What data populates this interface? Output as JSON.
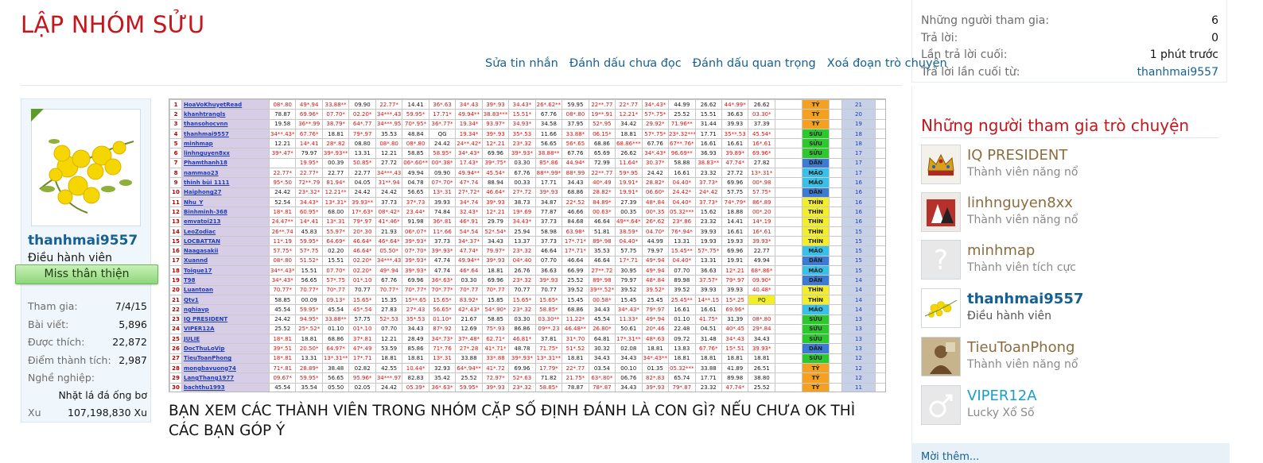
{
  "thread": {
    "title": "LẬP NHÓM SỬU",
    "caption": "BẠN XEM CÁC THÀNH VIÊN TRONG NHÓM CẶP SỐ ĐỊNH ĐÁNH LÀ CON GÌ? NẾU CHƯA OK THÌ CÁC BẠN GÓP Ý",
    "actions": [
      "Sửa tin nhắn",
      "Đánh dấu chưa đọc",
      "Đánh dấu quan trọng",
      "Xoá đoạn trò chuyện"
    ]
  },
  "poster": {
    "username": "thanhmai9557",
    "role": "Điều hành viên",
    "banner": "Miss thân thiện",
    "stats": [
      {
        "label": "Tham gia:",
        "value": "7/4/15"
      },
      {
        "label": "Bài viết:",
        "value": "5,896"
      },
      {
        "label": "Được thích:",
        "value": "22,872"
      },
      {
        "label": "Điểm thành tích:",
        "value": "2,987"
      }
    ],
    "job_label": "Nghề nghiệp:",
    "job_value": "Nhặt lá đá ống bơ",
    "xu_label": "Xu",
    "xu_value": "107,198,830 Xu"
  },
  "conversation_info": {
    "rows": [
      {
        "label": "Những người tham gia:",
        "value": "6"
      },
      {
        "label": "Trả lời:",
        "value": "0"
      },
      {
        "label": "Lần trả lời cuối:",
        "value": "1 phút trước"
      },
      {
        "label": "Trả lời lần cuối từ:",
        "value": "thanhmai9557"
      }
    ]
  },
  "participants": {
    "heading": "Những người tham gia trò chuyện",
    "members": [
      {
        "name": "IQ PRESIDENT",
        "title": "Thành viên năng nổ",
        "icon": "crown-icon"
      },
      {
        "name": "linhnguyen8xx",
        "title": "Thành viên năng nổ",
        "icon": "photo-avatar"
      },
      {
        "name": "minhmap",
        "title": "Thành viên tích cực",
        "icon": "question-mark-icon"
      },
      {
        "name": "thanhmai9557",
        "title": "Điều hành viên",
        "icon": "flower-avatar"
      },
      {
        "name": "TieuToanPhong",
        "title": "Thành viên năng nổ",
        "icon": "photo-avatar"
      },
      {
        "name": "VIPER12A",
        "title": "Lucky Xổ Số",
        "icon": "male-symbol-icon"
      }
    ],
    "invite_label": "Mời thêm..."
  },
  "sheet": {
    "rows": [
      {
        "n": "1",
        "name": "HoaVoKhuyetRead",
        "cells": [
          "08*.80",
          "49*.94",
          "33.88**",
          "09.90",
          "22.77*",
          "14.41",
          "36*.63",
          "34*.43",
          "39*.93",
          "34.43*",
          "26*.62**",
          "59.95",
          "22**.77",
          "22*.77",
          "34*.43*",
          "44.99",
          "26.62",
          "44*.99*",
          "26.62"
        ],
        "tag": "TÝ",
        "rank": "21",
        "color": "#f4a020"
      },
      {
        "n": "2",
        "name": "khanhtrangls",
        "cells": [
          "78.87",
          "69.96*",
          "07.70*",
          "02.20*",
          "34***.43",
          "59.95*",
          "17.71*",
          "49.94**",
          "38.83***",
          "15.51*",
          "67.76",
          "08*.80",
          "19**.91",
          "12.21*",
          "57*.75*",
          "25.52",
          "15.51",
          "36.63",
          "03.30*"
        ],
        "tag": "TÝ",
        "rank": "20",
        "color": "#f4a020"
      },
      {
        "n": "3",
        "name": "thansohocvnn",
        "cells": [
          "19.58",
          "36**.99",
          "38.79*",
          "64*.77",
          "34***.95",
          "70*.95*",
          "36*.77*",
          "19.34*",
          "93.97*",
          "34.93*",
          "34.58",
          "37.95",
          "52*.95",
          "34.42",
          "29.92*",
          "71.96**",
          "31.44",
          "39.93",
          "37.39"
        ],
        "tag": "TÝ",
        "rank": "19",
        "color": "#f4a020"
      },
      {
        "n": "4",
        "name": "thanhmai9557",
        "cells": [
          "34**.43*",
          "67.76*",
          "18.81",
          "79*.97",
          "35.53",
          "48.84",
          "QG",
          "19.34*",
          "39*.93",
          "35*.53",
          "11.66",
          "33.88*",
          "06.15*",
          "18.81",
          "57*.75*",
          "23*.32***",
          "17.71",
          "35**.53",
          "45.54*"
        ],
        "tag": "SỬU",
        "rank": "18",
        "color": "#2cc92c"
      },
      {
        "n": "5",
        "name": "minhmap",
        "cells": [
          "12.21",
          "14*.41",
          "28*.82",
          "08.80",
          "08*.80",
          "08*.80",
          "24.42",
          "24**.42*",
          "12*.21",
          "23*.32",
          "56.65",
          "56*.65",
          "68.86",
          "68.86***",
          "67.76",
          "67**.76*",
          "16.61",
          "16.61",
          "16*.61"
        ],
        "tag": "SỬU",
        "rank": "18",
        "color": "#2cc92c"
      },
      {
        "n": "6",
        "name": "linhnguyen8xx",
        "cells": [
          "39*.47*",
          "79.97",
          "39*.93**",
          "13.31",
          "12.21",
          "58.85",
          "58.95*",
          "34*.43*",
          "69.96",
          "39*.93*",
          "38.88**",
          "67.76",
          "65.69",
          "26.62",
          "34*.43*",
          "96.69**",
          "36.93",
          "39.89*",
          "69.96*"
        ],
        "tag": "SỬU",
        "rank": "17",
        "color": "#2cc92c"
      },
      {
        "n": "7",
        "name": "Phamthanh18",
        "cells": [
          "",
          "19.95*",
          "00.39",
          "50.85*",
          "27.72",
          "06*.60**",
          "00*.38*",
          "17.43*",
          "39*.75*",
          "03.30",
          "85*.86",
          "44.94*",
          "72.99",
          "11.64*",
          "30.37*",
          "58.88",
          "38.83**",
          "47.74*",
          "27.82"
        ],
        "tag": "DẦN",
        "rank": "17",
        "color": "#3b7bd4"
      },
      {
        "n": "8",
        "name": "nammao23",
        "cells": [
          "22.77*",
          "22.77*",
          "22.77",
          "22.77",
          "34***.43",
          "49.94",
          "09.90",
          "49.94**",
          "45.54*",
          "67.76",
          "88**.99*",
          "88*.99",
          "22**.77",
          "59*.95",
          "24.42",
          "16.61",
          "23.32",
          "27.72",
          "13*.31*"
        ],
        "tag": "MÃO",
        "rank": "17",
        "color": "#38c0e6"
      },
      {
        "n": "9",
        "name": "thinh bùi 1111",
        "cells": [
          "95*.50",
          "72**.79",
          "81.94*",
          "04.05",
          "31**.94",
          "04.78",
          "07*.70*",
          "47*.74",
          "88.94",
          "00.33",
          "17.71",
          "34.43",
          "40*.49",
          "19.91*",
          "28.82*",
          "04.40*",
          "37.73*",
          "69.96",
          "00*.98"
        ],
        "tag": "MÃO",
        "rank": "16",
        "color": "#38c0e6"
      },
      {
        "n": "10",
        "name": "Haiphong27",
        "cells": [
          "24.42",
          "23*.32*",
          "12.21**",
          "24.42",
          "24.42",
          "56.65",
          "13*.31",
          "27*.72*",
          "46.64*",
          "27*.72",
          "39*.93",
          "68.86",
          "28.82*",
          "19.91*",
          "06.60*",
          "24.42*",
          "24*.42",
          "57.75",
          "57.75*"
        ],
        "tag": "DẦN",
        "rank": "16",
        "color": "#3b7bd4"
      },
      {
        "n": "11",
        "name": "Nhu_Y",
        "cells": [
          "52.54",
          "34.43*",
          "13*.31*",
          "39.93**",
          "37.73",
          "37*.73",
          "39.93",
          "34*.74",
          "39*.93",
          "38.73",
          "34.87",
          "22*.52",
          "84.89*",
          "27.39",
          "48*.84",
          "04.40*",
          "37.73*",
          "74*.79*",
          "86*.89"
        ],
        "tag": "THÌN",
        "rank": "16",
        "color": "#f2ee2a"
      },
      {
        "n": "12",
        "name": "Binhminh-368",
        "cells": [
          "18*.81",
          "60.95*",
          "68.00",
          "17*.63*",
          "08*.42*",
          "23.44*",
          "74.84",
          "32.43*",
          "12*.21",
          "19*.69",
          "77.87",
          "46.66",
          "00.63*",
          "00.35",
          "00*.35",
          "05.32***",
          "15.62",
          "18.88",
          "00*.20"
        ],
        "tag": "THÌN",
        "rank": "16",
        "color": "#f2ee2a"
      },
      {
        "n": "13",
        "name": "emvatoi213",
        "cells": [
          "24.47**",
          "14*.41",
          "13*.31",
          "79*.97",
          "41*.46*",
          "91.98",
          "36*.81",
          "46*.91",
          "29.79",
          "34.43*",
          "37.73",
          "84.68",
          "46.64",
          "49**.64*",
          "26*.62",
          "23*.86",
          "23.32",
          "14.41",
          "14*.19"
        ],
        "tag": "THÌN",
        "rank": "16",
        "color": "#f2ee2a"
      },
      {
        "n": "14",
        "name": "LeoZodiac",
        "cells": [
          "26**.74",
          "45.83",
          "55.97*",
          "20*.30",
          "21.93",
          "06*.07*",
          "11*.66",
          "54*.54",
          "52*.54*",
          "25.94",
          "58.98",
          "63.98*",
          "51.81",
          "38.59*",
          "04.70*",
          "76*.94*",
          "39.93",
          "16.61",
          "16*.61"
        ],
        "tag": "THÌN",
        "rank": "15",
        "color": "#f2ee2a"
      },
      {
        "n": "15",
        "name": "LOCBATTAN",
        "cells": [
          "11*.19",
          "59.95*",
          "64.69*",
          "46.64*",
          "46*.64*",
          "39*.93*",
          "37.73",
          "34*.37*",
          "34.43",
          "13.37",
          "37.73",
          "17*.71*",
          "89*.98",
          "04.40*",
          "44.99",
          "13.31",
          "19.93",
          "19.93",
          "39.93*"
        ],
        "tag": "THÌN",
        "rank": "15",
        "color": "#f2ee2a"
      },
      {
        "n": "16",
        "name": "Naagasakii",
        "cells": [
          "57.75*",
          "57*.75",
          "02.20",
          "46.64*",
          "05.50*",
          "07*.70*",
          "39*.93*",
          "47.74*",
          "79.97*",
          "23*.32",
          "46.64",
          "17*.71*",
          "35.53",
          "57.75",
          "79.97",
          "15.45**",
          "57*.75*",
          "69.96",
          "22.77"
        ],
        "tag": "MÃO",
        "rank": "15",
        "color": "#38c0e6"
      },
      {
        "n": "17",
        "name": "Xuannd",
        "cells": [
          "08*.80",
          "51.52*",
          "15.51",
          "02.20*",
          "34***.43",
          "39*.93*",
          "47.74",
          "49.94**",
          "39*.93",
          "04*.40",
          "07.70",
          "46.64",
          "46.64",
          "17*.71",
          "49*.94",
          "04.40*",
          "13.31",
          "19.91",
          "49.94"
        ],
        "tag": "DẦN",
        "rank": "15",
        "color": "#3b7bd4"
      },
      {
        "n": "18",
        "name": "Toique17",
        "cells": [
          "34**.43*",
          "15.51",
          "07.70*",
          "02.20*",
          "49*.94",
          "39*.93*",
          "47.74",
          "46*.64",
          "18.81",
          "26.76",
          "36.63",
          "66.99",
          "27**.72",
          "30.95",
          "49*.94",
          "07.70",
          "36.63",
          "12*.21",
          "68*.86*"
        ],
        "tag": "MÃO",
        "rank": "15",
        "color": "#38c0e6"
      },
      {
        "n": "19",
        "name": "T98",
        "cells": [
          "34*.43*",
          "56.65",
          "57*.75",
          "01*.10",
          "67.76",
          "69.96",
          "36*.63*",
          "03.30",
          "69.96",
          "23*.32",
          "39*.93",
          "25.52",
          "89*.98",
          "79.97",
          "48*.84",
          "89.98",
          "37.57*",
          "79*.97",
          "09.90*"
        ],
        "tag": "DẦN",
        "rank": "14",
        "color": "#3b7bd4"
      },
      {
        "n": "20",
        "name": "Luantoan",
        "cells": [
          "70.77*",
          "70.77*",
          "70*.77",
          "70.77",
          "70.77*",
          "70*.77*",
          "70*.77*",
          "70*.77",
          "70*.77",
          "70.77",
          "70.77",
          "39.52",
          "39**.52*",
          "39.52",
          "39.52*",
          "39.52",
          "39.93",
          "39.93",
          "40.48*"
        ],
        "tag": "THÌN",
        "rank": "14",
        "color": "#f2ee2a"
      },
      {
        "n": "21",
        "name": "Qtv1",
        "cells": [
          "58.85",
          "00.09",
          "09.13*",
          "15.65*",
          "15.35",
          "15**.65",
          "15.65*",
          "83.92*",
          "15.85",
          "15.65*",
          "15.65*",
          "15.45",
          "00.58*",
          "15.45",
          "25.45",
          "25.45**",
          "14**.15",
          "15*.25",
          "PQ"
        ],
        "tag": "THÌN",
        "rank": "14",
        "color": "#f2ee2a"
      },
      {
        "n": "22",
        "name": "nghiavp",
        "cells": [
          "45.54",
          "59.95*",
          "45.54",
          "45*.54",
          "27.83",
          "27*.43",
          "56.65*",
          "42*.43*",
          "54*.90*",
          "23*.32",
          "58.85*",
          "68.86",
          "34.43",
          "34*.43*",
          "79*.97",
          "16.61",
          "16.61",
          "69.96*"
        ],
        "tag": "MÃO",
        "rank": "14",
        "color": "#38c0e6"
      },
      {
        "n": "23",
        "name": "IQ PRESIDENT",
        "cells": [
          "24.42",
          "94.95*",
          "33.88**",
          "57.75",
          "52*.53",
          "35*.53",
          "01.10*",
          "21.67",
          "58.85",
          "03.30",
          "03.30**",
          "11.22*",
          "45.54",
          "11.33*",
          "49*.94",
          "01.10",
          "41.75*",
          "31.39",
          "08*.80"
        ],
        "tag": "SỬU",
        "rank": "13",
        "color": "#2cc92c"
      },
      {
        "n": "24",
        "name": "VIPER12A",
        "cells": [
          "25.52",
          "25*.52*",
          "01.10",
          "01*.10",
          "07.70",
          "34.43",
          "87*.92",
          "12.69",
          "75*.93",
          "86.86",
          "09**.23",
          "46.48**",
          "26.80*",
          "50.61",
          "20*.46",
          "22.48",
          "04.51",
          "40*.45",
          "29*.84"
        ],
        "tag": "SỬU",
        "rank": "13",
        "color": "#2cc92c"
      },
      {
        "n": "25",
        "name": "JULIE",
        "cells": [
          "18*.81",
          "18.81",
          "68.86",
          "37*.81",
          "12.21",
          "28.49",
          "34*.73*",
          "37*.48*",
          "62.71*",
          "46.81*",
          "37.81",
          "31*.70",
          "64.81",
          "17*.31**",
          "48*.63",
          "09.72",
          "31.48",
          "34*.43",
          "34.43"
        ],
        "tag": "SỬU",
        "rank": "13",
        "color": "#2cc92c"
      },
      {
        "n": "26",
        "name": "DocThuLoVip",
        "cells": [
          "39*.51",
          "20.50*",
          "64.97*",
          "47*.49",
          "53.59",
          "85.86",
          "71*.76",
          "27*.28",
          "41*.71*",
          "48.78",
          "71.75*",
          "51*.52",
          "30.32",
          "02.08",
          "18.81",
          "13.83",
          "67.76*",
          "15*.51",
          "39.93*"
        ],
        "tag": "DẦN",
        "rank": "13",
        "color": "#3b7bd4"
      },
      {
        "n": "27",
        "name": "TieuToanPhong",
        "cells": [
          "18*.81",
          "13.31",
          "13*.31**",
          "17*.71",
          "18.81",
          "18.81",
          "13*.31",
          "33.88",
          "33*.88",
          "39*.93*",
          "13*.31**",
          "18.81",
          "34.43",
          "34.43",
          "34*.43**",
          "18.81",
          "18.81",
          "18.81",
          "18.81"
        ],
        "tag": "SỬU",
        "rank": "12",
        "color": "#2cc92c"
      },
      {
        "n": "28",
        "name": "mongbavuong74",
        "cells": [
          "71*.81",
          "28.89*",
          "38.48",
          "02.82",
          "42.55",
          "10.44*",
          "32.93",
          "64*.94**",
          "41*.72",
          "69.96",
          "17.79*",
          "22*.77",
          "03.54",
          "00.10",
          "01.35",
          "05.32***",
          "33.88",
          "41.89",
          "26.51"
        ],
        "tag": "TÝ",
        "rank": "12",
        "color": "#f4a020"
      },
      {
        "n": "29",
        "name": "LangThang1977",
        "cells": [
          "09.67*",
          "59.95*",
          "56.65",
          "95.96*",
          "34***.97",
          "82.83",
          "35.42",
          "25.52",
          "72.97*",
          "52*.63",
          "71.82",
          "21.75*",
          "63*.80*",
          "06.76",
          "82*.83",
          "65.74",
          "17.71",
          "89.98",
          "38.80"
        ],
        "tag": "TÝ",
        "rank": "12",
        "color": "#f4a020"
      },
      {
        "n": "30",
        "name": "bachthu1993",
        "cells": [
          "45.54",
          "35.54",
          "05.50",
          "02.05",
          "24.42",
          "05.39*",
          "36*.63*",
          "59.95*",
          "39*.93",
          "23*.32",
          "58.85*",
          "78.87",
          "78*.87",
          "34.43",
          "39*.93",
          "79*.87",
          "23.32",
          "47.74*",
          "25.52"
        ],
        "tag": "TÝ",
        "rank": "11",
        "color": "#f4a020"
      }
    ]
  }
}
